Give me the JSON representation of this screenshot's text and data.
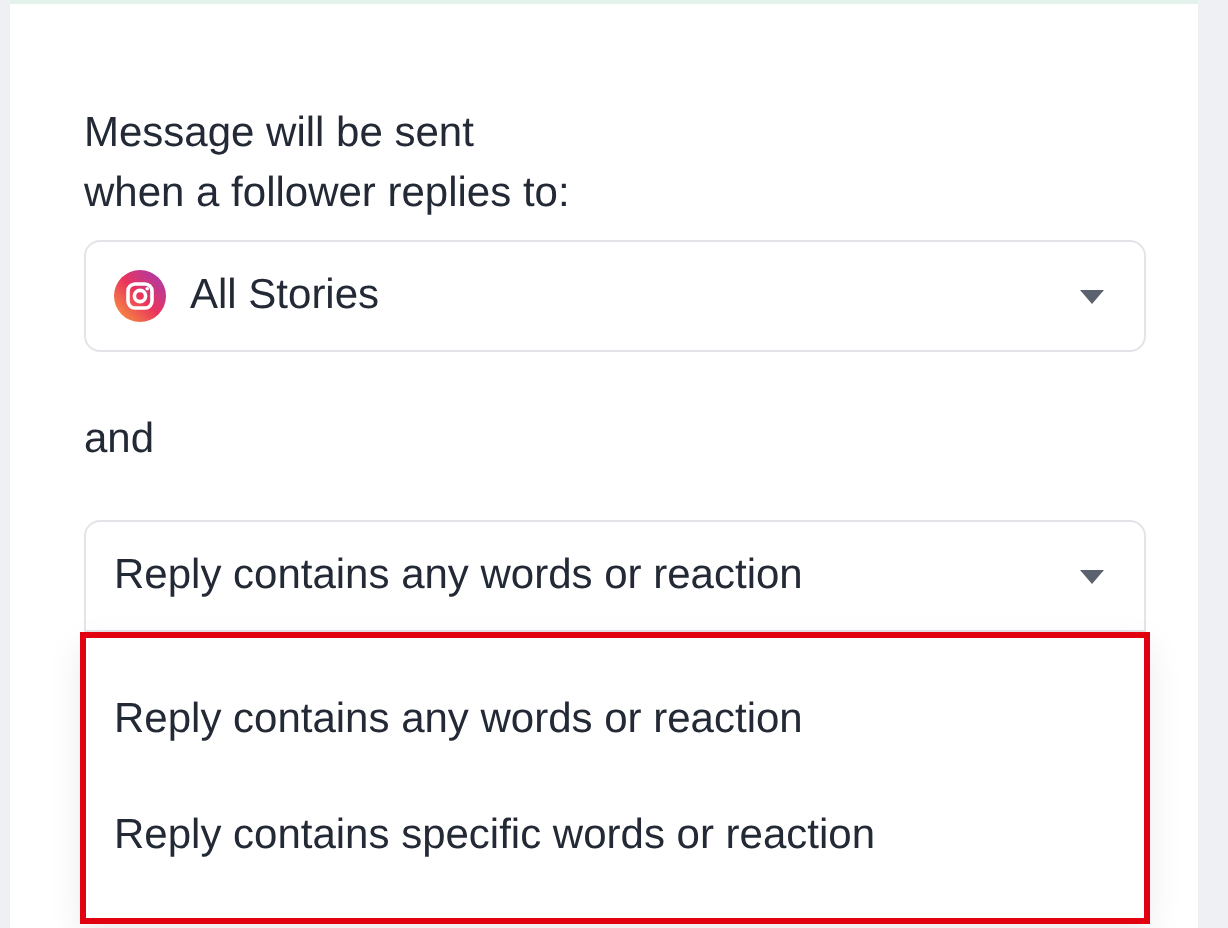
{
  "prompt": [
    "Message will be sent",
    "when a follower replies to:"
  ],
  "source_select": {
    "value": "All Stories"
  },
  "connector": "and",
  "condition_select": {
    "value": "Reply contains any words or reaction",
    "expanded": true
  },
  "condition_options": [
    "Reply contains any words or reaction",
    "Reply contains specific words or reaction"
  ]
}
